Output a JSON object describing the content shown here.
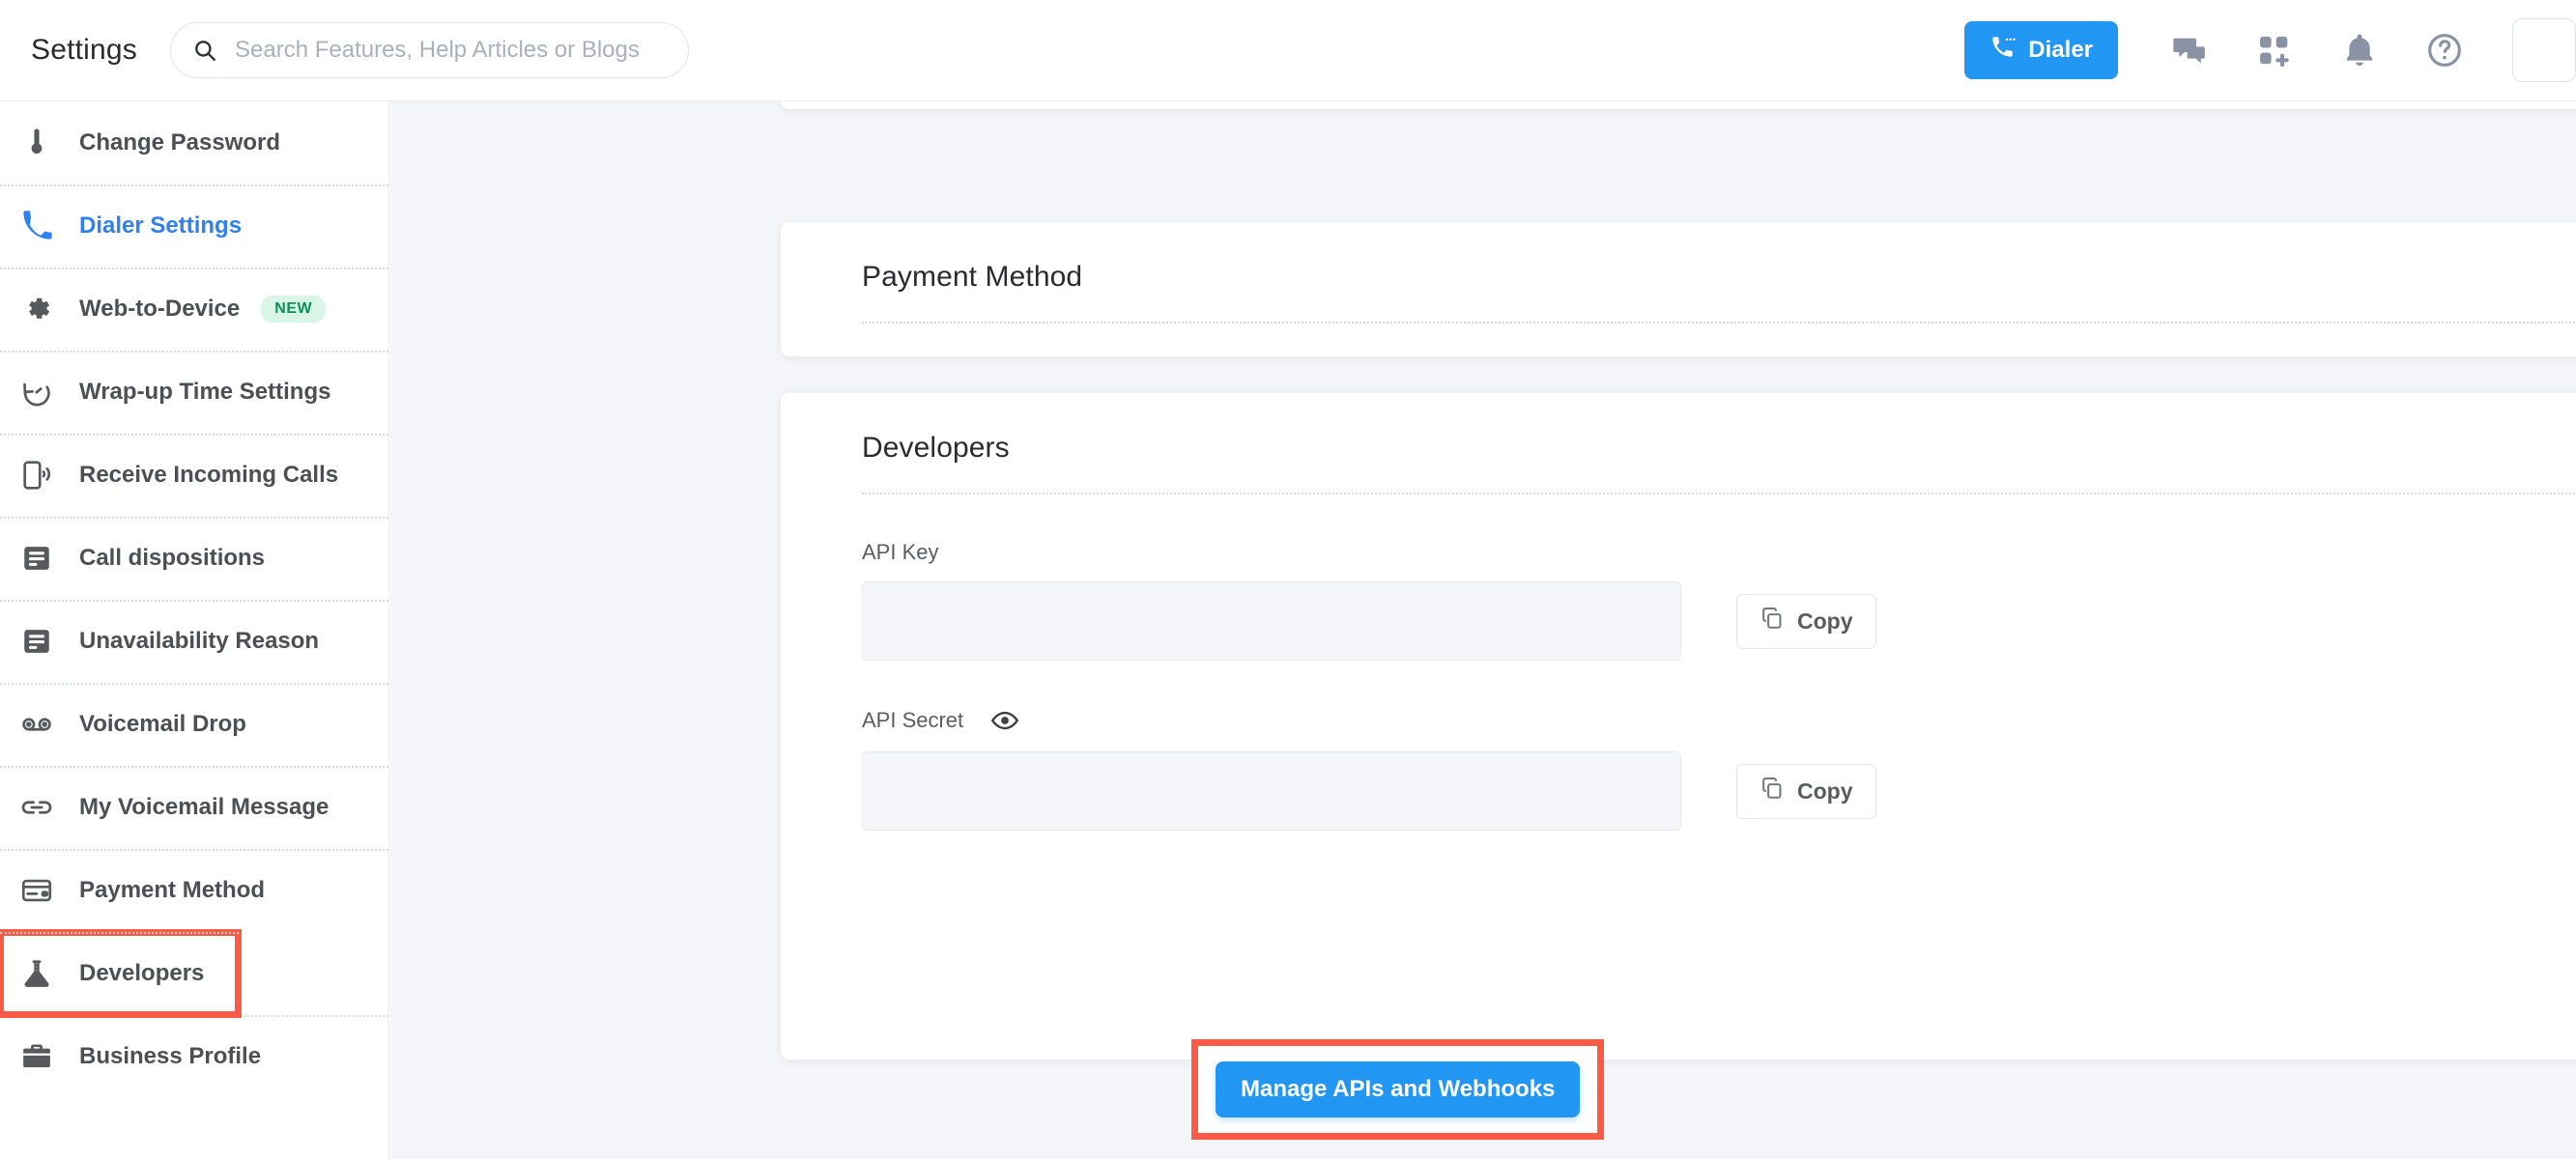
{
  "header": {
    "title": "Settings",
    "search": {
      "placeholder": "Search Features, Help Articles or Blogs",
      "value": "",
      "icon": "search-icon"
    },
    "dialer_button": {
      "label": "Dialer",
      "icon": "phone-call-icon",
      "color": "#2196f3"
    },
    "icons": [
      {
        "name": "chat-bubbles-icon"
      },
      {
        "name": "apps-grid-plus-icon"
      },
      {
        "name": "bell-notification-icon"
      },
      {
        "name": "help-circle-icon"
      }
    ]
  },
  "sidebar": {
    "items": [
      {
        "label": "Change Password",
        "icon": "key-icon",
        "active": false,
        "badge": "",
        "highlighted": false
      },
      {
        "label": "Dialer Settings",
        "icon": "phone-icon",
        "active": true,
        "badge": "",
        "highlighted": false
      },
      {
        "label": "Web-to-Device",
        "icon": "gear-icon",
        "active": false,
        "badge": "NEW",
        "highlighted": false
      },
      {
        "label": "Wrap-up Time Settings",
        "icon": "stopwatch-icon",
        "active": false,
        "badge": "",
        "highlighted": false
      },
      {
        "label": "Receive Incoming Calls",
        "icon": "mobile-ring-icon",
        "active": false,
        "badge": "",
        "highlighted": false
      },
      {
        "label": "Call dispositions",
        "icon": "list-card-icon",
        "active": false,
        "badge": "",
        "highlighted": false
      },
      {
        "label": "Unavailability Reason",
        "icon": "list-card-icon",
        "active": false,
        "badge": "",
        "highlighted": false
      },
      {
        "label": "Voicemail Drop",
        "icon": "voicemail-icon",
        "active": false,
        "badge": "",
        "highlighted": false
      },
      {
        "label": "My Voicemail Message",
        "icon": "link-chain-icon",
        "active": false,
        "badge": "",
        "highlighted": false
      },
      {
        "label": "Payment Method",
        "icon": "credit-card-icon",
        "active": false,
        "badge": "",
        "highlighted": false
      },
      {
        "label": "Developers",
        "icon": "flask-icon",
        "active": false,
        "badge": "",
        "highlighted": true
      },
      {
        "label": "Business Profile",
        "icon": "briefcase-icon",
        "active": false,
        "badge": "",
        "highlighted": false
      }
    ],
    "badge_color": "#0d8f5c",
    "active_color": "#2f80f0",
    "highlight_color": "#fa5b47"
  },
  "main": {
    "payment_card": {
      "title": "Payment Method"
    },
    "developers_card": {
      "title": "Developers",
      "api_key": {
        "label": "API Key",
        "value": "",
        "copy_label": "Copy",
        "copy_icon": "copy-icon"
      },
      "api_secret": {
        "label": "API Secret",
        "value": "",
        "reveal_icon": "eye-icon",
        "copy_label": "Copy",
        "copy_icon": "copy-icon"
      },
      "manage_button": {
        "label": "Manage APIs and Webhooks",
        "color": "#2196f3",
        "highlighted": true
      }
    }
  }
}
